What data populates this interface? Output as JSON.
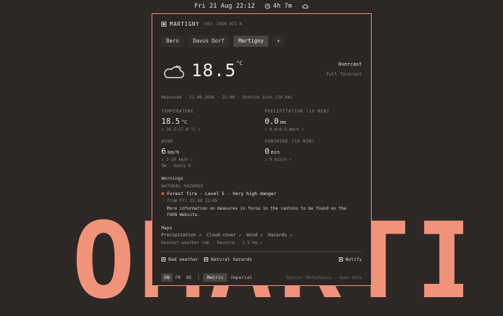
{
  "topbar": {
    "datetime": "Fri 21 Aug 22:12",
    "timer": "4h 7m"
  },
  "background_text": "OMARTIGNY",
  "header": {
    "location": "MARTIGNY",
    "canton": "(VS)",
    "elevation": "1920 471 m"
  },
  "tabs": [
    "Bern",
    "Davos Dorf",
    "Martigny",
    "+"
  ],
  "current": {
    "temperature": "18.5",
    "unit": "°C",
    "condition": "Overcast",
    "forecast_link": "Full forecast"
  },
  "measured": "Measured · 21.08.2026 · 22:00 · Station Sion (24 km)",
  "metrics": {
    "temperature": {
      "label": "TEMPERATURE",
      "value": "18.5",
      "unit": "°C",
      "range": "↕ 16.1–17.4 °C ↑"
    },
    "precipitation": {
      "label": "PRECIPITATION (10 MIN)",
      "value": "0.0",
      "unit": "mm",
      "range": "↕ 0.0–0.5 mm/h ↑"
    },
    "wind": {
      "label": "WIND",
      "value": "6",
      "unit": "km/h",
      "range": "↕ 1–10 km/h ↑",
      "direction": "SW · Gusts 9"
    },
    "sunshine": {
      "label": "SUNSHINE (10 MIN)",
      "value": "0",
      "unit": "min",
      "range": "↕ 0 min/h ↑"
    }
  },
  "warnings": {
    "title": "Warnings",
    "category": "NATURAL HAZARDS",
    "headline": "Forest fire · Level 5 · Very high danger",
    "since": "from Fri 21.08 12:05",
    "info": "More information on measures in force in the cantons to be found on the FOEN Website."
  },
  "maps": {
    "title": "Maps",
    "links": [
      "Precipitation ↗",
      "Cloud cover ↗",
      "Wind ↗",
      "Hazards ↗"
    ],
    "nearest": "Nearest weather cam · Ravoire · 1.5 km ↗"
  },
  "options": {
    "bad_weather": "Bad weather",
    "natural_hazards": "Natural hazards",
    "notify": "Notify"
  },
  "footer": {
    "languages": [
      "EN",
      "FR",
      "DE"
    ],
    "units": [
      "Metric",
      "Imperial"
    ],
    "source": "· Source: MeteoSwiss · Open data"
  }
}
